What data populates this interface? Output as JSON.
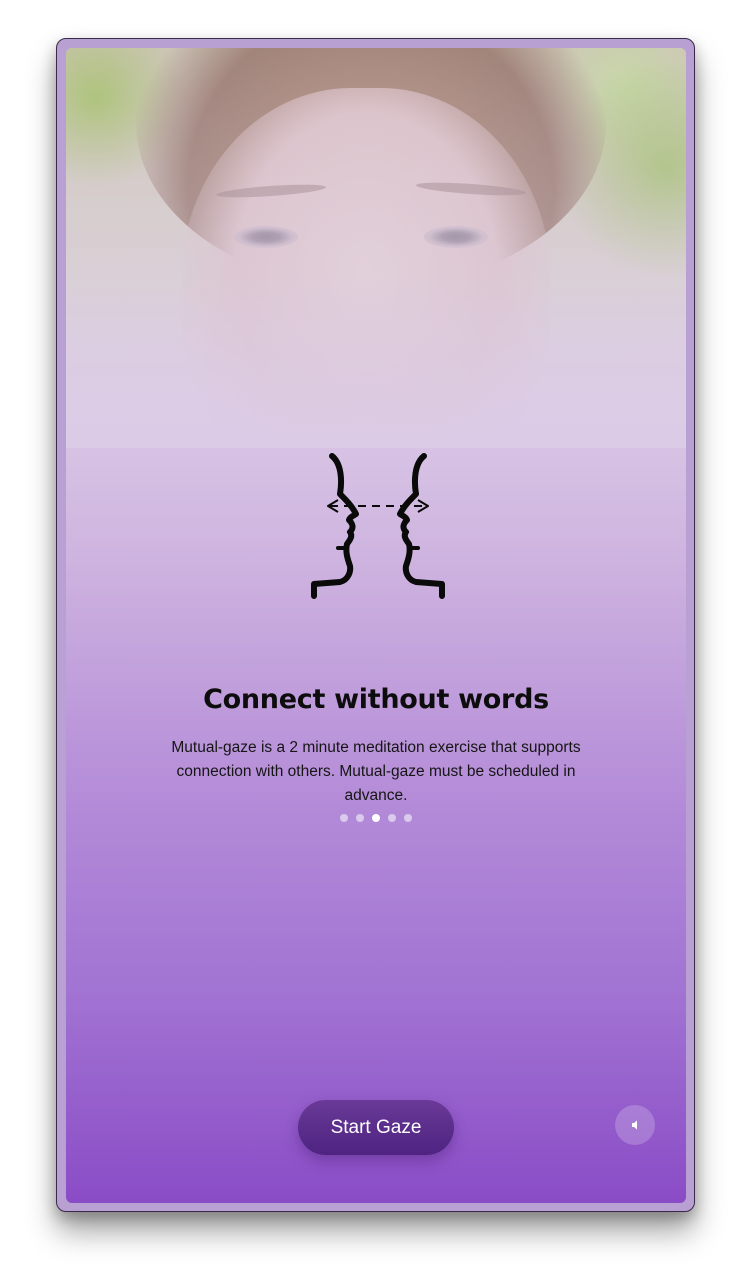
{
  "onboarding": {
    "title": "Connect without words",
    "description": "Mutual-gaze is a 2 minute meditation exercise that supports connection with others. Mutual-gaze must be scheduled in advance.",
    "illustration_icon": "mutual-gaze-faces-icon",
    "pagination": {
      "total": 5,
      "active_index": 2
    }
  },
  "actions": {
    "start_label": "Start Gaze",
    "sound_icon": "speaker-icon"
  },
  "colors": {
    "gradient_top": "#dcd0e8",
    "gradient_bottom": "#8a4cc6",
    "button": "#5a2d8c"
  }
}
